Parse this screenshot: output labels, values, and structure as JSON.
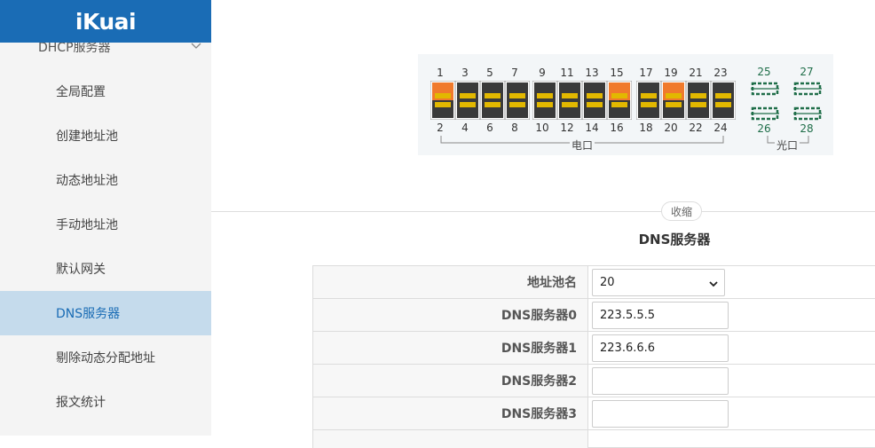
{
  "logo": "iKuai",
  "sidebar": {
    "parent_label": "DHCP服务器",
    "items": [
      {
        "label": "全局配置"
      },
      {
        "label": "创建地址池"
      },
      {
        "label": "动态地址池"
      },
      {
        "label": "手动地址池"
      },
      {
        "label": "默认网关"
      },
      {
        "label": "DNS服务器",
        "active": true
      },
      {
        "label": "剔除动态分配地址"
      },
      {
        "label": "报文统计"
      }
    ]
  },
  "ports": {
    "top_row": [
      "1",
      "3",
      "5",
      "7",
      "9",
      "11",
      "13",
      "15",
      "17",
      "19",
      "21",
      "23"
    ],
    "bottom_row": [
      "2",
      "4",
      "6",
      "8",
      "10",
      "12",
      "14",
      "16",
      "18",
      "20",
      "22",
      "24"
    ],
    "fiber_top": [
      "25",
      "27"
    ],
    "fiber_bottom": [
      "26",
      "28"
    ],
    "active_ports": [
      "1",
      "15",
      "19"
    ],
    "copper_label": "电口",
    "fiber_label": "光口",
    "colors": {
      "active": "#f07a2c",
      "inactive": "#3a3a3a",
      "led": "#e2b800",
      "fiber": "#1f6e49"
    }
  },
  "collapse_label": "收缩",
  "section_title": "DNS服务器",
  "form": {
    "rows": [
      {
        "label": "地址池名",
        "value": "20",
        "type": "select"
      },
      {
        "label": "DNS服务器0",
        "value": "223.5.5.5",
        "type": "input"
      },
      {
        "label": "DNS服务器1",
        "value": "223.6.6.6",
        "type": "input"
      },
      {
        "label": "DNS服务器2",
        "value": "",
        "type": "input"
      },
      {
        "label": "DNS服务器3",
        "value": "",
        "type": "input"
      }
    ]
  }
}
